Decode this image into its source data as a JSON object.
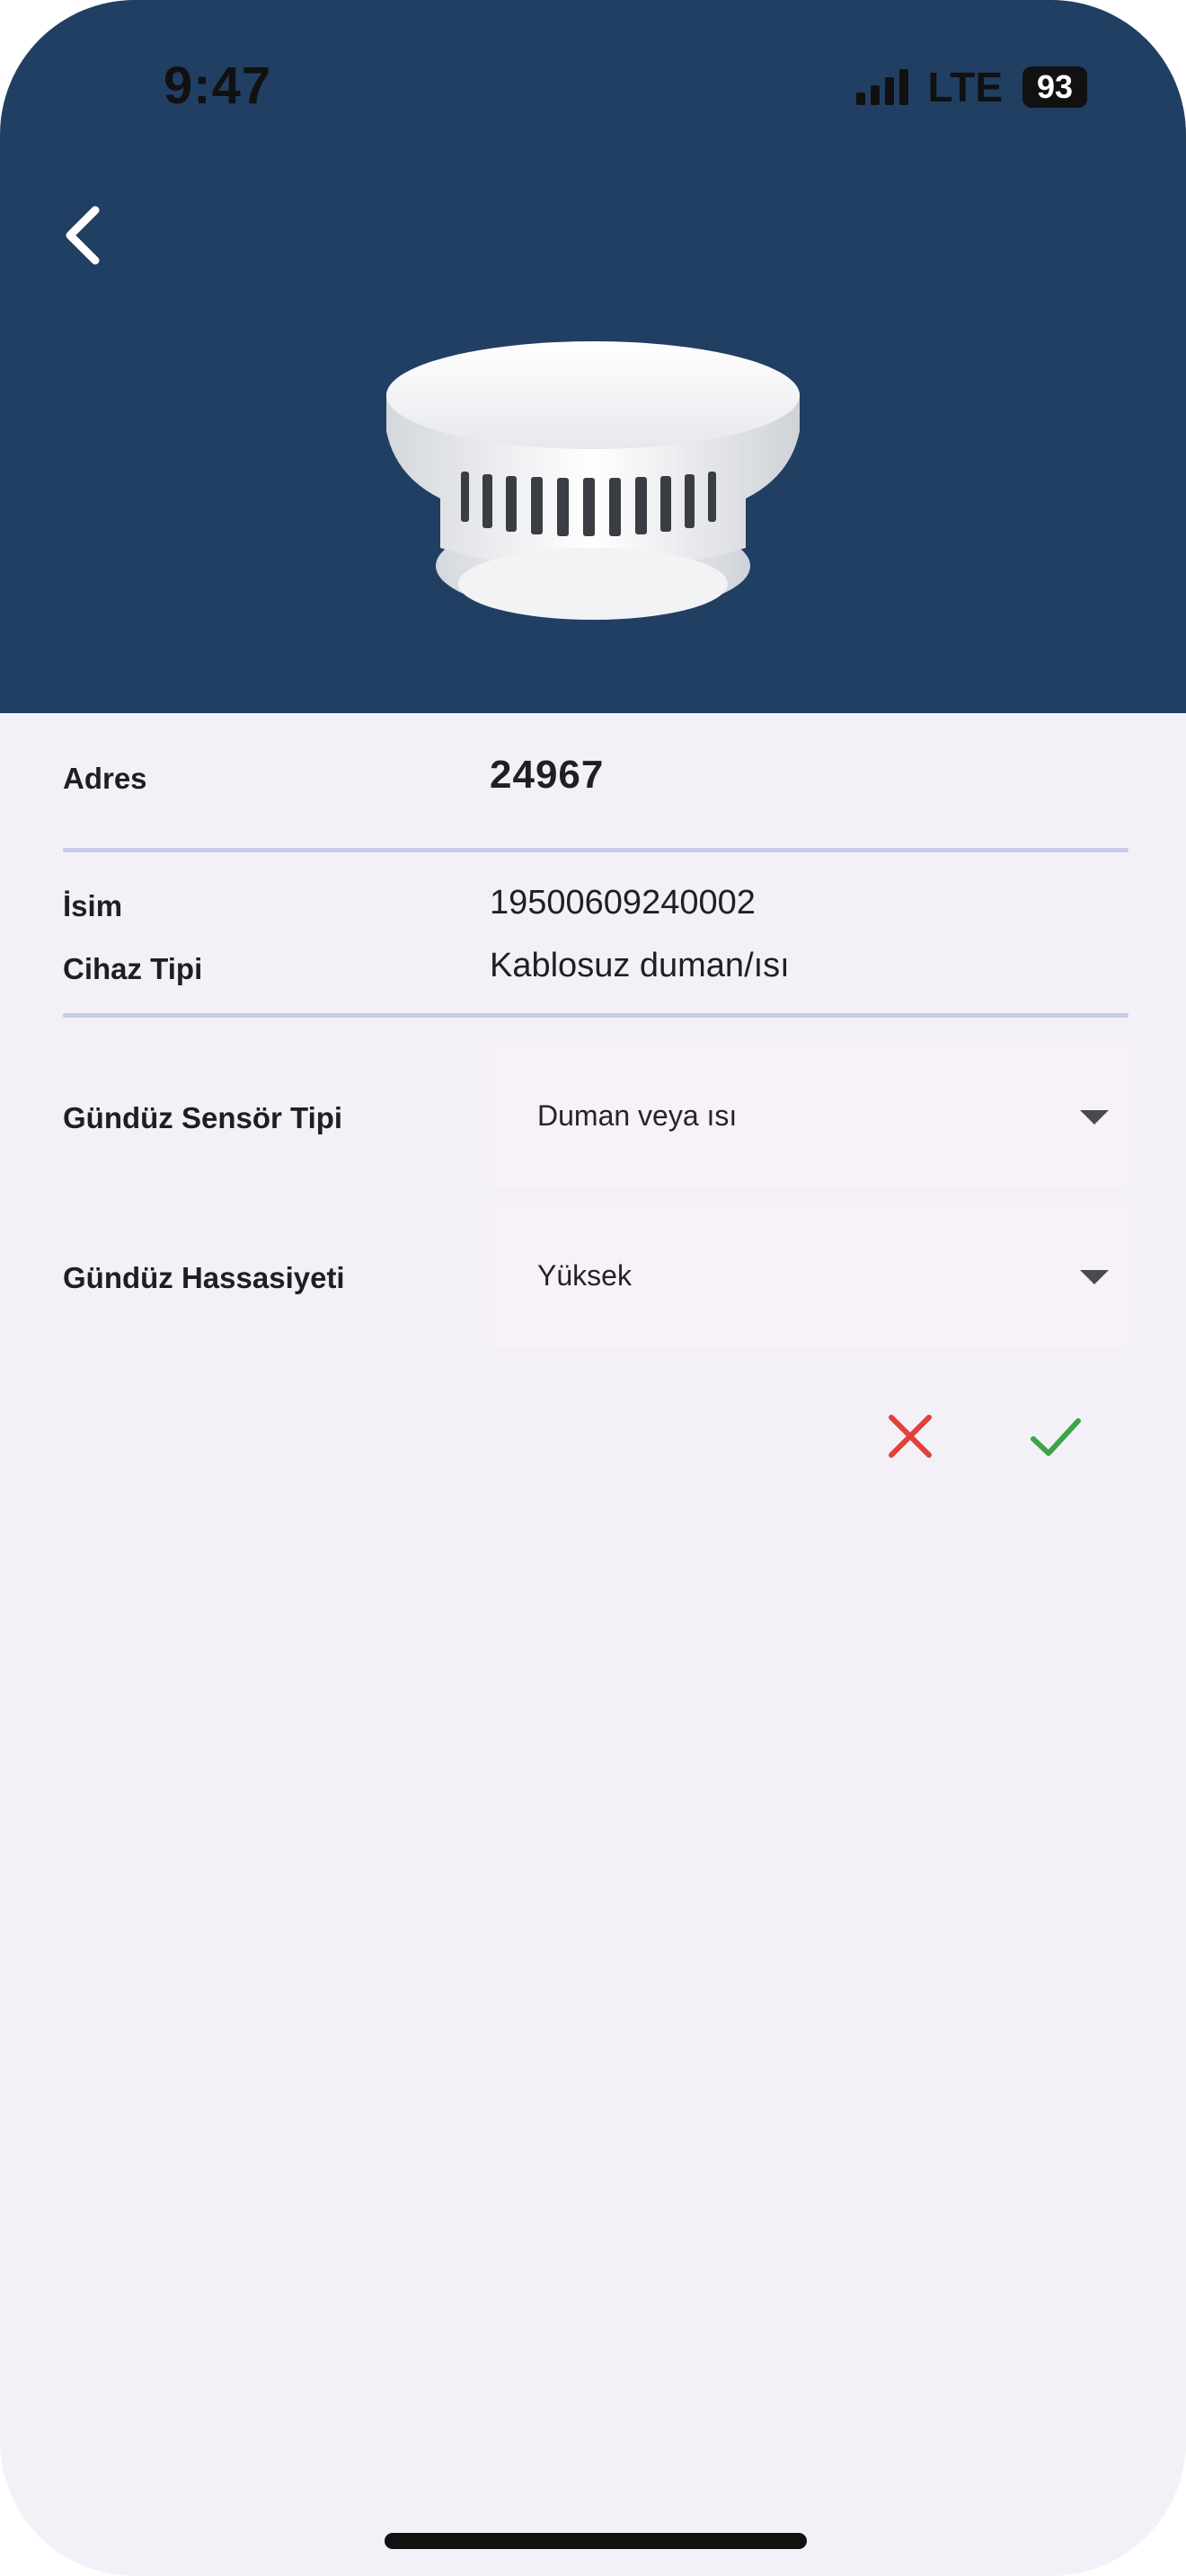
{
  "status_bar": {
    "time": "9:47",
    "network": "LTE",
    "battery": "93"
  },
  "header": {
    "back_icon": "chevron-left-icon",
    "device_image": "smoke-detector"
  },
  "details": {
    "address": {
      "label": "Adres",
      "value": "24967"
    },
    "name": {
      "label": "İsim",
      "value": "19500609240002"
    },
    "device_type": {
      "label": "Cihaz Tipi",
      "value": "Kablosuz duman/ısı"
    }
  },
  "settings": {
    "day_sensor_type": {
      "label": "Gündüz Sensör Tipi",
      "selected": "Duman veya ısı"
    },
    "day_sensitivity": {
      "label": "Gündüz Hassasiyeti",
      "selected": "Yüksek"
    }
  },
  "actions": {
    "cancel_icon": "close-icon",
    "confirm_icon": "check-icon"
  },
  "colors": {
    "header_bg": "#213f63",
    "cancel": "#e0413b",
    "confirm": "#3fa34d",
    "divider": "#c6cbe6",
    "page_bg": "#f3f1f7"
  }
}
